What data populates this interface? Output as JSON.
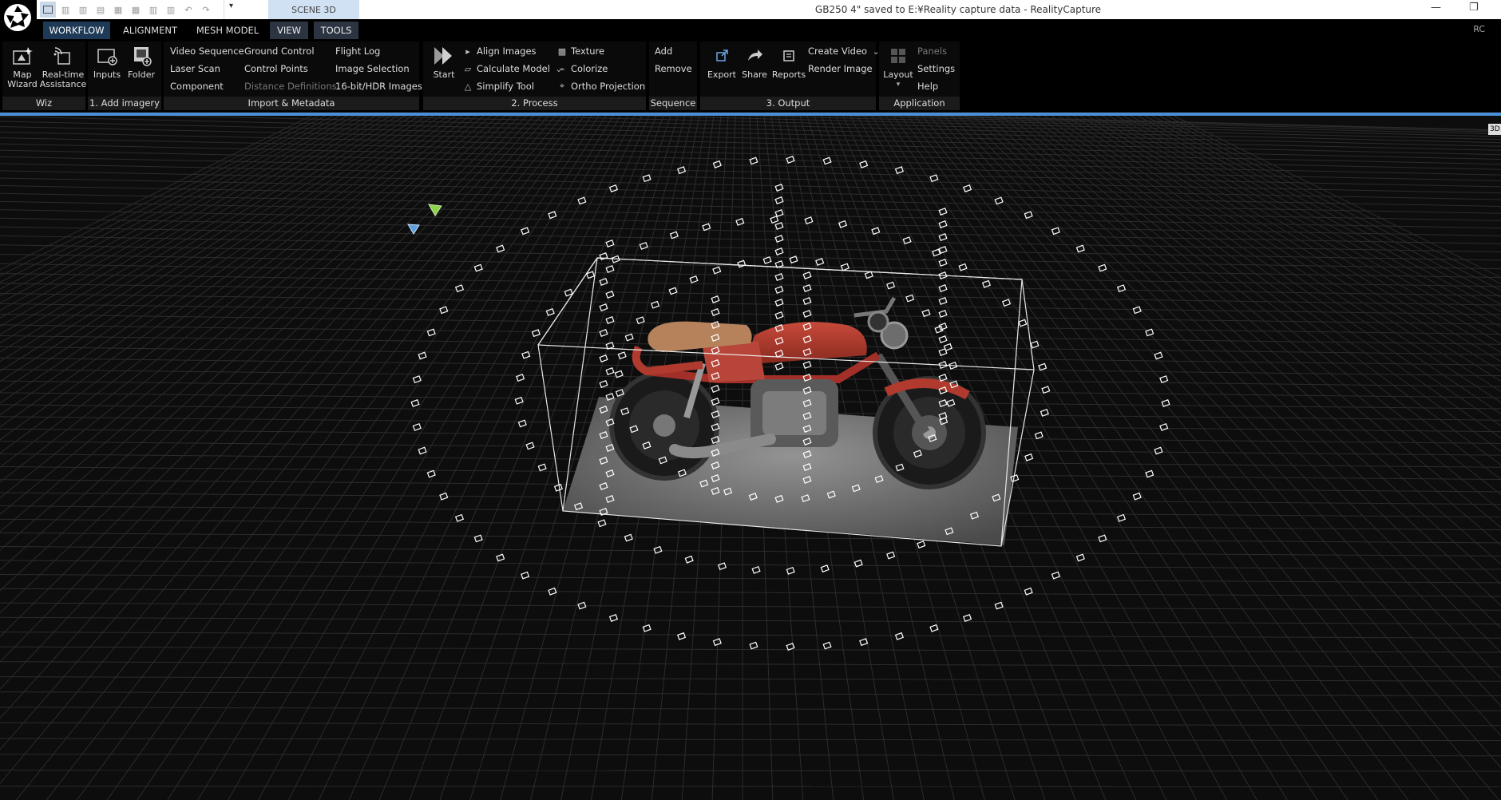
{
  "titlebar": {
    "window_title": "GB250 4\" saved to E:¥Reality capture data - RealityCapture",
    "scene_tab": "SCENE 3D",
    "minimize": "—",
    "restore": "❐",
    "qat_caret": "▾"
  },
  "tabs": [
    {
      "label": "WORKFLOW",
      "state": "active"
    },
    {
      "label": "ALIGNMENT",
      "state": "normal"
    },
    {
      "label": "MESH MODEL",
      "state": "normal"
    },
    {
      "label": "VIEW",
      "state": "boxed"
    },
    {
      "label": "TOOLS",
      "state": "boxed"
    }
  ],
  "rc_label": "RC",
  "ribbon": {
    "wiz": {
      "label": "Wiz",
      "map_wizard": "Map\nWizard",
      "realtime": "Real-time\nAssistance"
    },
    "add_imagery": {
      "label": "1. Add imagery",
      "inputs": "Inputs",
      "folder": "Folder"
    },
    "import_metadata": {
      "label": "Import & Metadata",
      "col1": [
        "Video Sequence",
        "Laser Scan",
        "Component"
      ],
      "col2": [
        "Ground Control",
        "Control Points",
        "Distance Definitions"
      ],
      "col3": [
        "Flight Log",
        "Image Selection",
        "16-bit/HDR Images"
      ]
    },
    "process": {
      "label": "2. Process",
      "start": "Start",
      "align_images": "Align Images",
      "calculate_model": "Calculate Model",
      "simplify_tool": "Simplify Tool",
      "texture": "Texture",
      "colorize": "Colorize",
      "ortho_projection": "Ortho Projection"
    },
    "sequence": {
      "label": "Sequence",
      "add": "Add",
      "remove": "Remove"
    },
    "output": {
      "label": "3. Output",
      "export": "Export",
      "share": "Share",
      "reports": "Reports",
      "create_video": "Create Video",
      "render_image": "Render Image"
    },
    "application": {
      "label": "Application",
      "layout": "Layout",
      "panels": "Panels",
      "settings": "Settings",
      "help": "Help"
    }
  },
  "viewport": {
    "badge": "3D",
    "colors": {
      "grid": "#2c2c2c",
      "bbox": "#e8e8e8",
      "camera": "#ffffff",
      "selected_camera_green": "#8bd44a",
      "selected_camera_blue": "#5aa0e0",
      "accent": "#4b8fd6"
    }
  }
}
